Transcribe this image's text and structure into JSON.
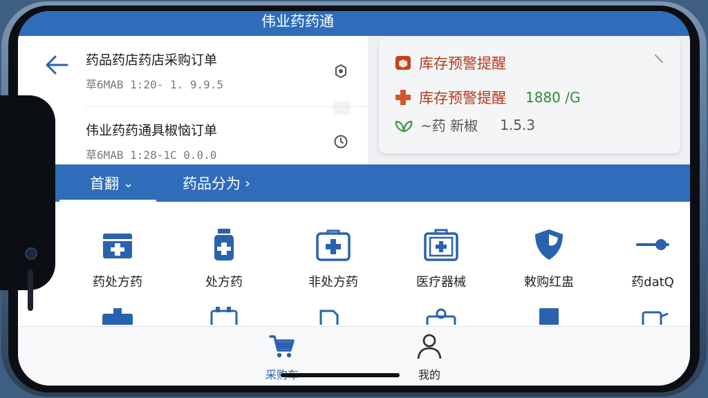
{
  "app": {
    "title": "伟业药药通"
  },
  "orders": [
    {
      "title": "药品药店药店采购订单",
      "subtitle": "草6MAB 1:20- 1. 9.9.5"
    },
    {
      "title": "伟业药药通具椒恼订单",
      "subtitle": "草6MAB 1:28-1C 0.0.0"
    }
  ],
  "alert_card": {
    "title": "库存预警提醒",
    "line_label": "库存预警提醒",
    "line_count": "1880 /G",
    "version_label": "~药 新椒",
    "version_value": "1.5.3"
  },
  "nav": {
    "items": [
      {
        "label": "首翻",
        "chevron": "⌄"
      },
      {
        "label": "药品分为",
        "chevron": "›"
      }
    ]
  },
  "categories": [
    {
      "label": "药处方药",
      "icon": "medical-kit-icon"
    },
    {
      "label": "处方药",
      "icon": "pill-bottle-icon"
    },
    {
      "label": "非处方药",
      "icon": "first-aid-kit-icon"
    },
    {
      "label": "医疗器械",
      "icon": "medical-case-icon"
    },
    {
      "label": "敕购红盅",
      "icon": "shield-icon"
    },
    {
      "label": "药datQ",
      "icon": "slider-icon"
    }
  ],
  "tabs": [
    {
      "label": "采购车",
      "icon": "cart-icon"
    },
    {
      "label": "我的",
      "icon": "user-icon"
    }
  ],
  "colors": {
    "brand": "#2f6dba",
    "alert_red": "#b03a1e",
    "alert_green": "#2f8a3a",
    "icon_blue": "#2a62ad"
  }
}
